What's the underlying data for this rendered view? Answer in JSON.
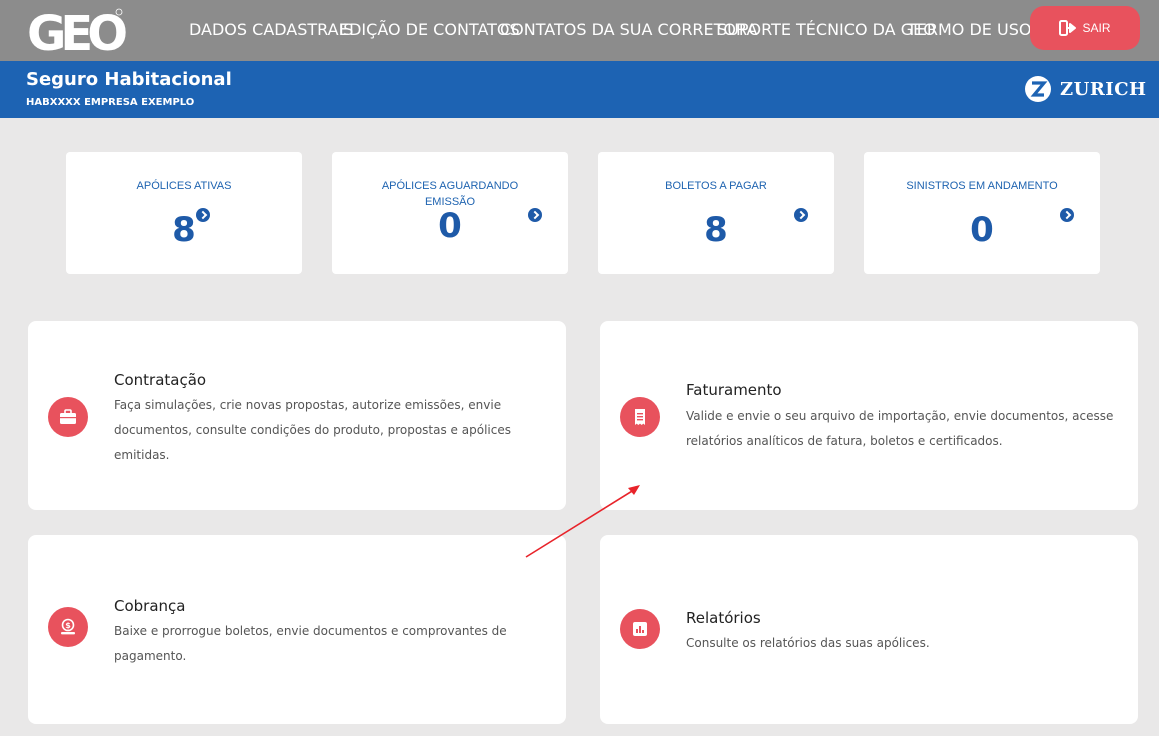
{
  "nav": {
    "logo_text": "GEO",
    "items": [
      "DADOS CADASTRAIS",
      "EDIÇÃO DE CONTATOS",
      "CONTATOS DA SUA CORRETORA",
      "SUPORTE TÉCNICO DA GEO",
      "TERMO DE USO"
    ],
    "logout_label": "SAIR"
  },
  "header": {
    "title": "Seguro Habitacional",
    "company_code": "HABXXXX",
    "company_name": "EMPRESA EXEMPLO",
    "brand": "ZURICH"
  },
  "stats": [
    {
      "label": "APÓLICES ATIVAS",
      "value": "8"
    },
    {
      "label": "APÓLICES AGUARDANDO EMISSÃO",
      "value": "0"
    },
    {
      "label": "BOLETOS A PAGAR",
      "value": "8"
    },
    {
      "label": "SINISTROS EM ANDAMENTO",
      "value": "0"
    }
  ],
  "cards": {
    "contratacao": {
      "title": "Contratação",
      "description": "Faça simulações, crie novas propostas, autorize emissões, envie documentos, consulte condições do produto, propostas e apólices emitidas."
    },
    "faturamento": {
      "title": "Faturamento",
      "description": "Valide e envie o seu arquivo de importação, envie documentos, acesse relatórios analíticos de fatura, boletos e certificados."
    },
    "cobranca": {
      "title": "Cobrança",
      "description": "Baixe e prorrogue boletos, envie documentos e comprovantes de pagamento."
    },
    "relatorios": {
      "title": "Relatórios",
      "description": "Consulte os relatórios das suas apólices."
    }
  },
  "colors": {
    "topbar": "#8c8c8c",
    "header_blue": "#1d63b3",
    "accent_red": "#e8525d",
    "stat_blue": "#1e5aa8",
    "background": "#e9e8e8"
  }
}
